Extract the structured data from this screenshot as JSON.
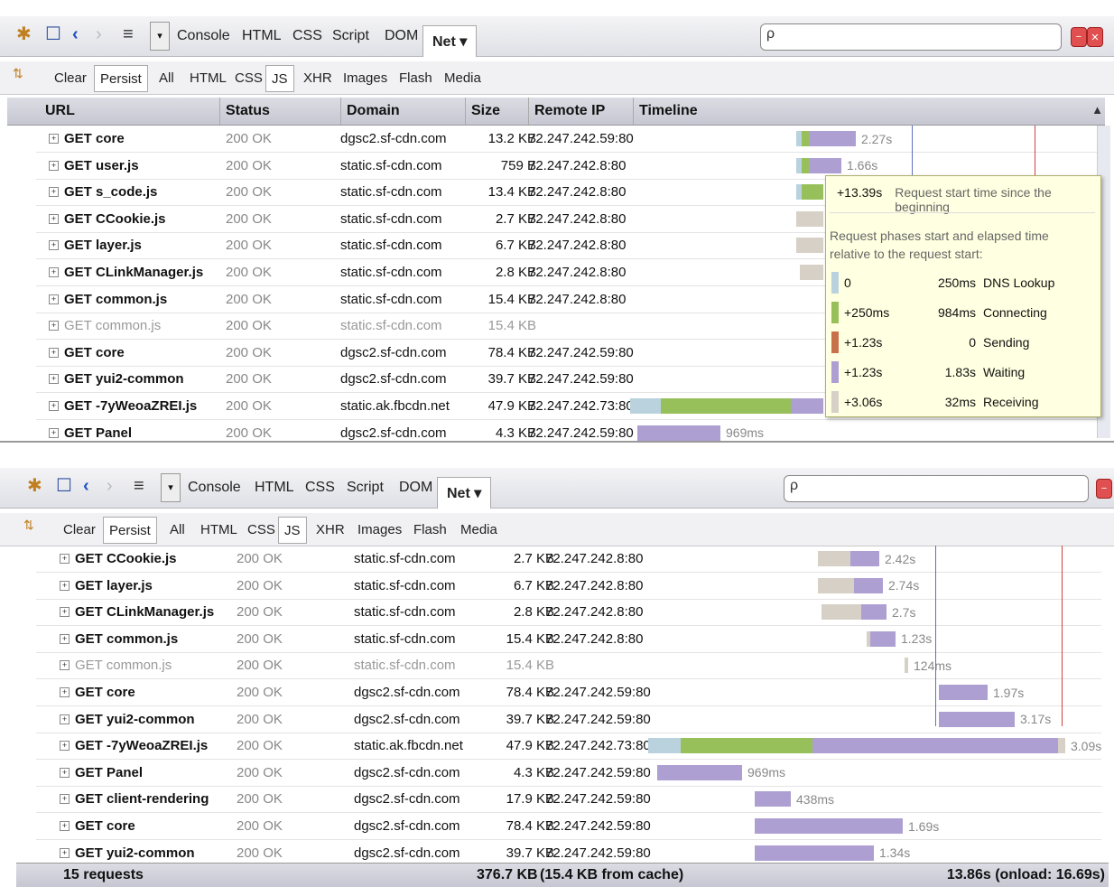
{
  "toolbar": {
    "tabs": [
      "Console",
      "HTML",
      "CSS",
      "Script",
      "DOM"
    ],
    "net_tab": "Net ▾",
    "search_value": ""
  },
  "filters": [
    "Clear",
    "Persist",
    "All",
    "HTML",
    "CSS",
    "JS",
    "XHR",
    "Images",
    "Flash",
    "Media"
  ],
  "columns": [
    "URL",
    "Status",
    "Domain",
    "Size",
    "Remote IP",
    "Timeline"
  ],
  "panel1_rows": [
    {
      "url": "GET core",
      "status": "200 OK",
      "domain": "dgsc2.sf-cdn.com",
      "size": "13.2 KB",
      "ip": "72.247.242.59:80",
      "time": "2.27s"
    },
    {
      "url": "GET user.js",
      "status": "200 OK",
      "domain": "static.sf-cdn.com",
      "size": "759 B",
      "ip": "72.247.242.8:80",
      "time": "1.66s"
    },
    {
      "url": "GET s_code.js",
      "status": "200 OK",
      "domain": "static.sf-cdn.com",
      "size": "13.4 KB",
      "ip": "72.247.242.8:80",
      "time": ""
    },
    {
      "url": "GET CCookie.js",
      "status": "200 OK",
      "domain": "static.sf-cdn.com",
      "size": "2.7 KB",
      "ip": "72.247.242.8:80",
      "time": ""
    },
    {
      "url": "GET layer.js",
      "status": "200 OK",
      "domain": "static.sf-cdn.com",
      "size": "6.7 KB",
      "ip": "72.247.242.8:80",
      "time": ""
    },
    {
      "url": "GET CLinkManager.js",
      "status": "200 OK",
      "domain": "static.sf-cdn.com",
      "size": "2.8 KB",
      "ip": "72.247.242.8:80",
      "time": ""
    },
    {
      "url": "GET common.js",
      "status": "200 OK",
      "domain": "static.sf-cdn.com",
      "size": "15.4 KB",
      "ip": "72.247.242.8:80",
      "time": ""
    },
    {
      "url": "GET common.js",
      "status": "200 OK",
      "domain": "static.sf-cdn.com",
      "size": "15.4 KB",
      "ip": "",
      "time": "",
      "grey": true
    },
    {
      "url": "GET core",
      "status": "200 OK",
      "domain": "dgsc2.sf-cdn.com",
      "size": "78.4 KB",
      "ip": "72.247.242.59:80",
      "time": ""
    },
    {
      "url": "GET yui2-common",
      "status": "200 OK",
      "domain": "dgsc2.sf-cdn.com",
      "size": "39.7 KB",
      "ip": "72.247.242.59:80",
      "time": ""
    },
    {
      "url": "GET -7yWeoaZREI.js",
      "status": "200 OK",
      "domain": "static.ak.fbcdn.net",
      "size": "47.9 KB",
      "ip": "72.247.242.73:80",
      "time": ""
    },
    {
      "url": "GET Panel",
      "status": "200 OK",
      "domain": "dgsc2.sf-cdn.com",
      "size": "4.3 KB",
      "ip": "72.247.242.59:80",
      "time": "969ms"
    }
  ],
  "tooltip": {
    "start": "+13.39s",
    "start_desc": "Request start time since the beginning",
    "intro": "Request phases start and elapsed time relative to the request start:",
    "phases": [
      {
        "start": "0",
        "elapsed": "250ms",
        "name": "DNS Lookup",
        "color": "#b9d2de"
      },
      {
        "start": "+250ms",
        "elapsed": "984ms",
        "name": "Connecting",
        "color": "#97c05a"
      },
      {
        "start": "+1.23s",
        "elapsed": "0",
        "name": "Sending",
        "color": "#c8704a"
      },
      {
        "start": "+1.23s",
        "elapsed": "1.83s",
        "name": "Waiting",
        "color": "#ae9fd2"
      },
      {
        "start": "+3.06s",
        "elapsed": "32ms",
        "name": "Receiving",
        "color": "#d6d0c6"
      }
    ]
  },
  "panel2_rows": [
    {
      "url": "GET CCookie.js",
      "status": "200 OK",
      "domain": "static.sf-cdn.com",
      "size": "2.7 KB",
      "ip": "72.247.242.8:80",
      "time": "2.42s"
    },
    {
      "url": "GET layer.js",
      "status": "200 OK",
      "domain": "static.sf-cdn.com",
      "size": "6.7 KB",
      "ip": "72.247.242.8:80",
      "time": "2.74s"
    },
    {
      "url": "GET CLinkManager.js",
      "status": "200 OK",
      "domain": "static.sf-cdn.com",
      "size": "2.8 KB",
      "ip": "72.247.242.8:80",
      "time": "2.7s"
    },
    {
      "url": "GET common.js",
      "status": "200 OK",
      "domain": "static.sf-cdn.com",
      "size": "15.4 KB",
      "ip": "72.247.242.8:80",
      "time": "1.23s"
    },
    {
      "url": "GET common.js",
      "status": "200 OK",
      "domain": "static.sf-cdn.com",
      "size": "15.4 KB",
      "ip": "",
      "time": "124ms",
      "grey": true
    },
    {
      "url": "GET core",
      "status": "200 OK",
      "domain": "dgsc2.sf-cdn.com",
      "size": "78.4 KB",
      "ip": "72.247.242.59:80",
      "time": "1.97s"
    },
    {
      "url": "GET yui2-common",
      "status": "200 OK",
      "domain": "dgsc2.sf-cdn.com",
      "size": "39.7 KB",
      "ip": "72.247.242.59:80",
      "time": "3.17s"
    },
    {
      "url": "GET -7yWeoaZREI.js",
      "status": "200 OK",
      "domain": "static.ak.fbcdn.net",
      "size": "47.9 KB",
      "ip": "72.247.242.73:80",
      "time": "3.09s"
    },
    {
      "url": "GET Panel",
      "status": "200 OK",
      "domain": "dgsc2.sf-cdn.com",
      "size": "4.3 KB",
      "ip": "72.247.242.59:80",
      "time": "969ms"
    },
    {
      "url": "GET client-rendering",
      "status": "200 OK",
      "domain": "dgsc2.sf-cdn.com",
      "size": "17.9 KB",
      "ip": "72.247.242.59:80",
      "time": "438ms"
    },
    {
      "url": "GET core",
      "status": "200 OK",
      "domain": "dgsc2.sf-cdn.com",
      "size": "78.4 KB",
      "ip": "72.247.242.59:80",
      "time": "1.69s"
    },
    {
      "url": "GET yui2-common",
      "status": "200 OK",
      "domain": "dgsc2.sf-cdn.com",
      "size": "39.7 KB",
      "ip": "72.247.242.59:80",
      "time": "1.34s"
    }
  ],
  "summary": {
    "requests": "15 requests",
    "size": "376.7 KB",
    "cache": "(15.4 KB from cache)",
    "time": "13.86s (onload: 16.69s)"
  }
}
